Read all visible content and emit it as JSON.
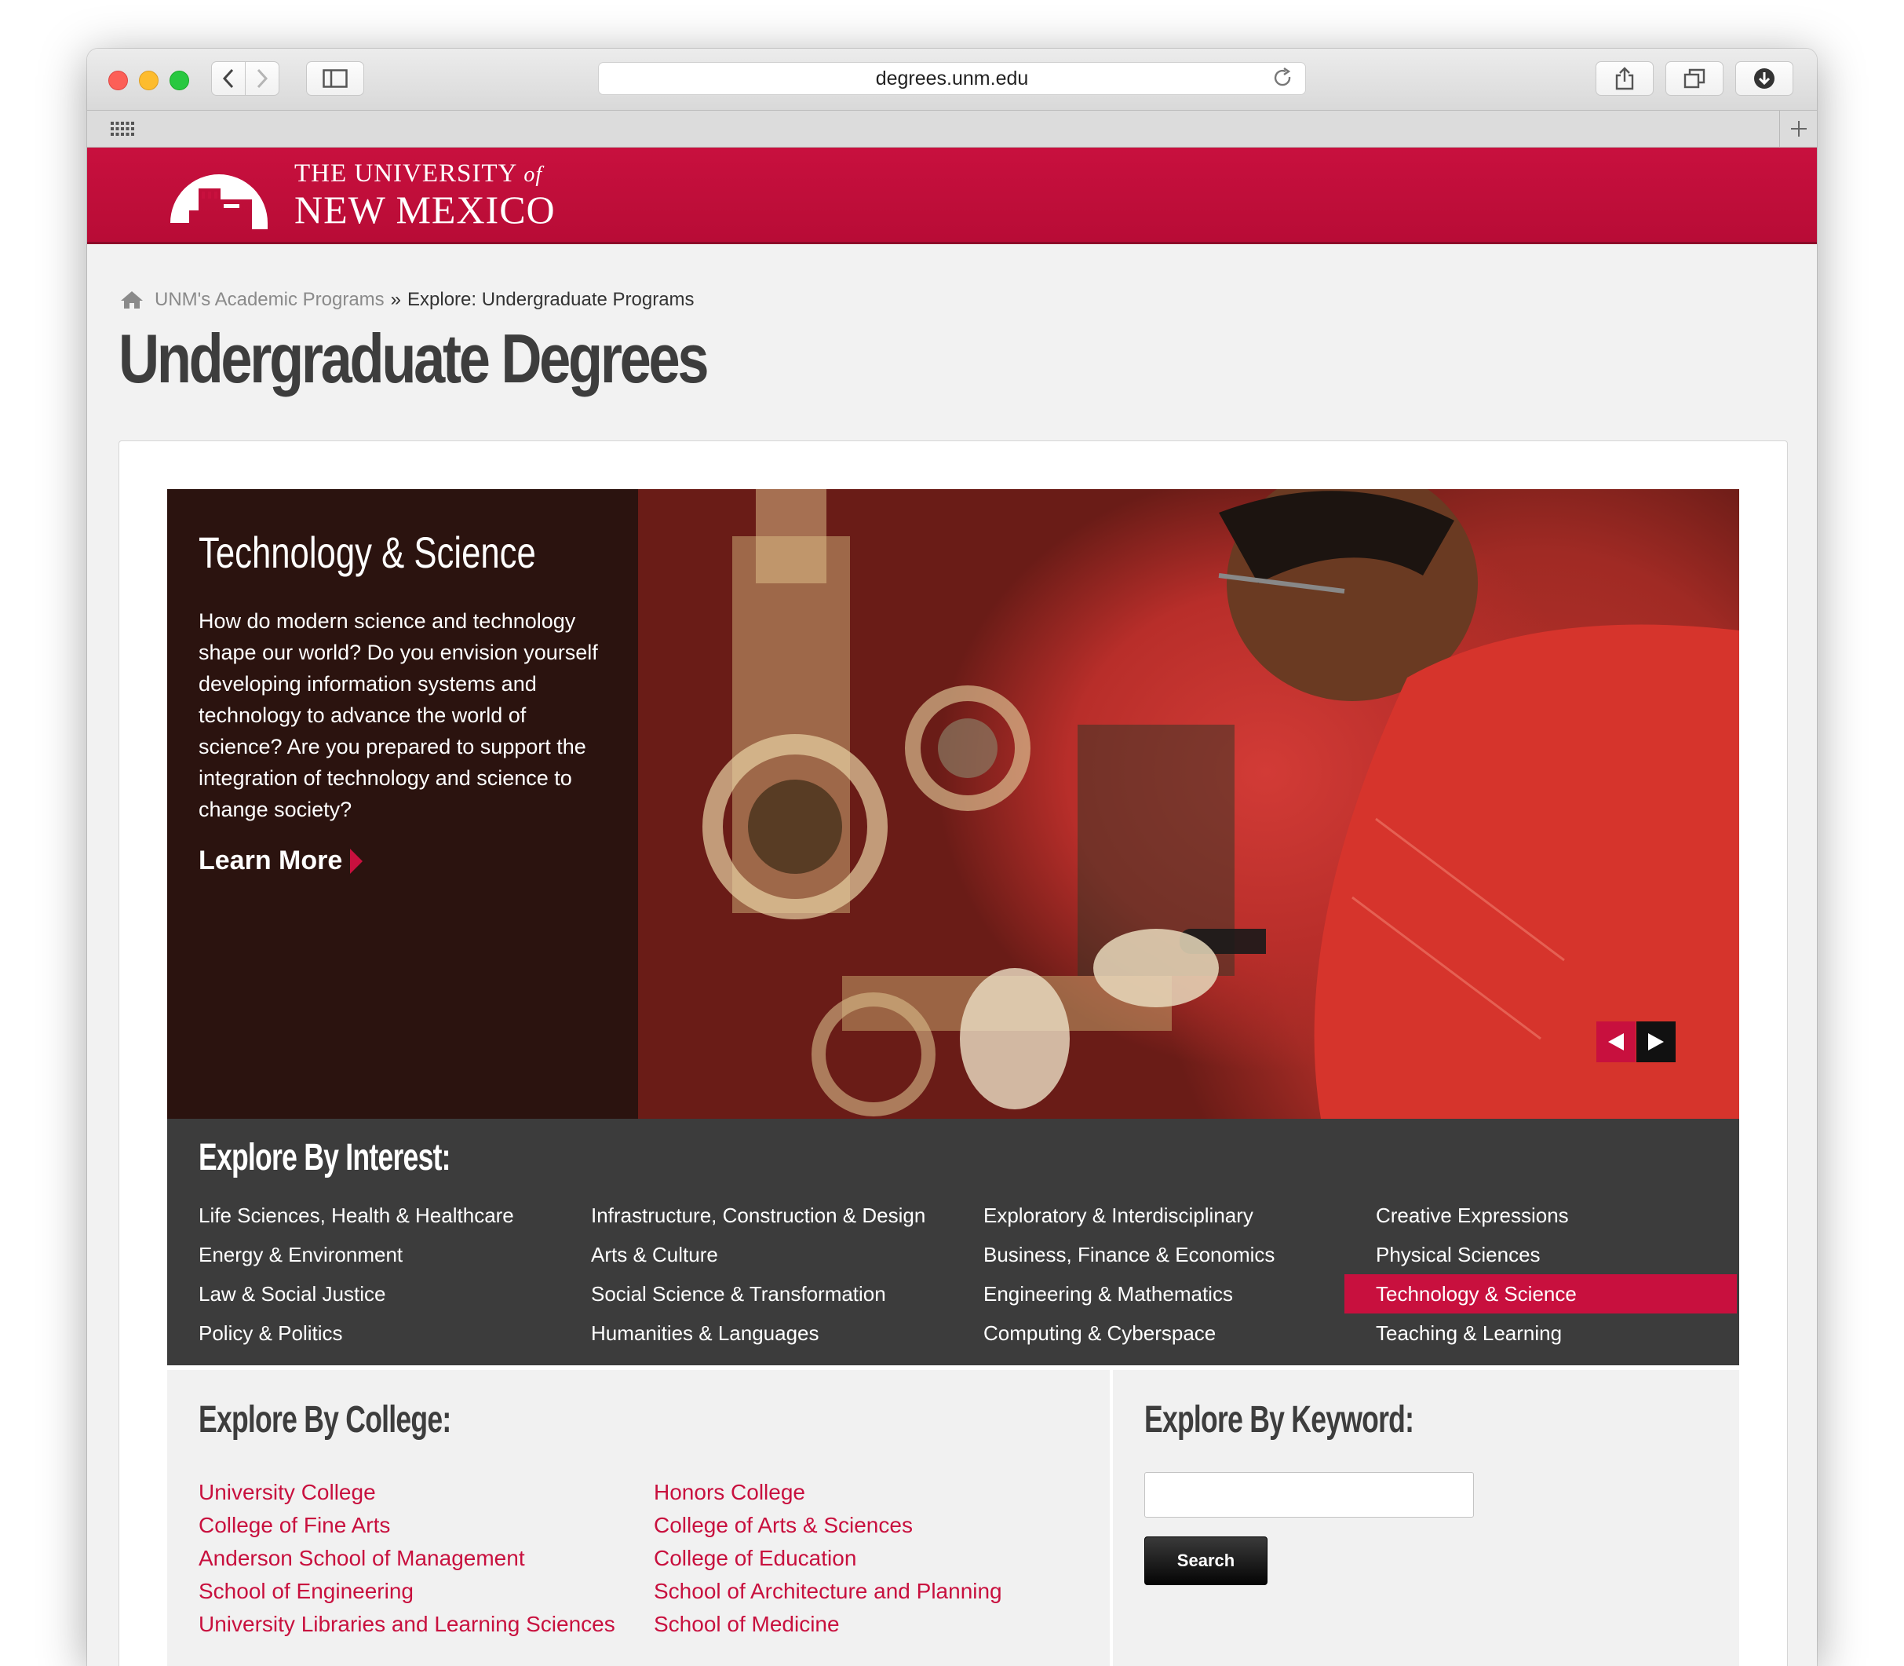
{
  "browser": {
    "url": "degrees.unm.edu"
  },
  "header": {
    "logo_line1": "THE UNIVERSITY",
    "logo_of": "of",
    "logo_line2": "NEW MEXICO"
  },
  "breadcrumb": {
    "parent": "UNM's Academic Programs",
    "separator": "»",
    "current": "Explore: Undergraduate Programs"
  },
  "page_title": "Undergraduate Degrees",
  "hero": {
    "title": "Technology & Science",
    "body": "How do modern science and technology shape our world? Do you envision yourself developing information systems and technology to advance the world of science? Are you prepared to support the integration of technology and science to change society?",
    "learn_more": "Learn More"
  },
  "interest": {
    "title": "Explore By Interest:",
    "items": [
      "Life Sciences, Health & Healthcare",
      "Infrastructure, Construction & Design",
      "Exploratory & Interdisciplinary",
      "Creative Expressions",
      "Energy & Environment",
      "Arts & Culture",
      "Business, Finance & Economics",
      "Physical Sciences",
      "Law & Social Justice",
      "Social Science & Transformation",
      "Engineering & Mathematics",
      "Technology & Science",
      "Policy & Politics",
      "Humanities & Languages",
      "Computing & Cyberspace",
      "Teaching & Learning"
    ],
    "active": "Technology & Science"
  },
  "college": {
    "title": "Explore By College:",
    "links": [
      "University College",
      "College of Fine Arts",
      "Anderson School of Management",
      "School of Engineering",
      "University Libraries and Learning Sciences",
      "Honors College",
      "College of Arts & Sciences",
      "College of Education",
      "School of Architecture and Planning",
      "School of Medicine"
    ]
  },
  "keyword": {
    "title": "Explore By Keyword:",
    "input_value": "",
    "search_label": "Search"
  },
  "colors": {
    "unm_red": "#c8103e",
    "dark_panel": "#3c3c3c",
    "title_gray": "#3d3d3d"
  }
}
